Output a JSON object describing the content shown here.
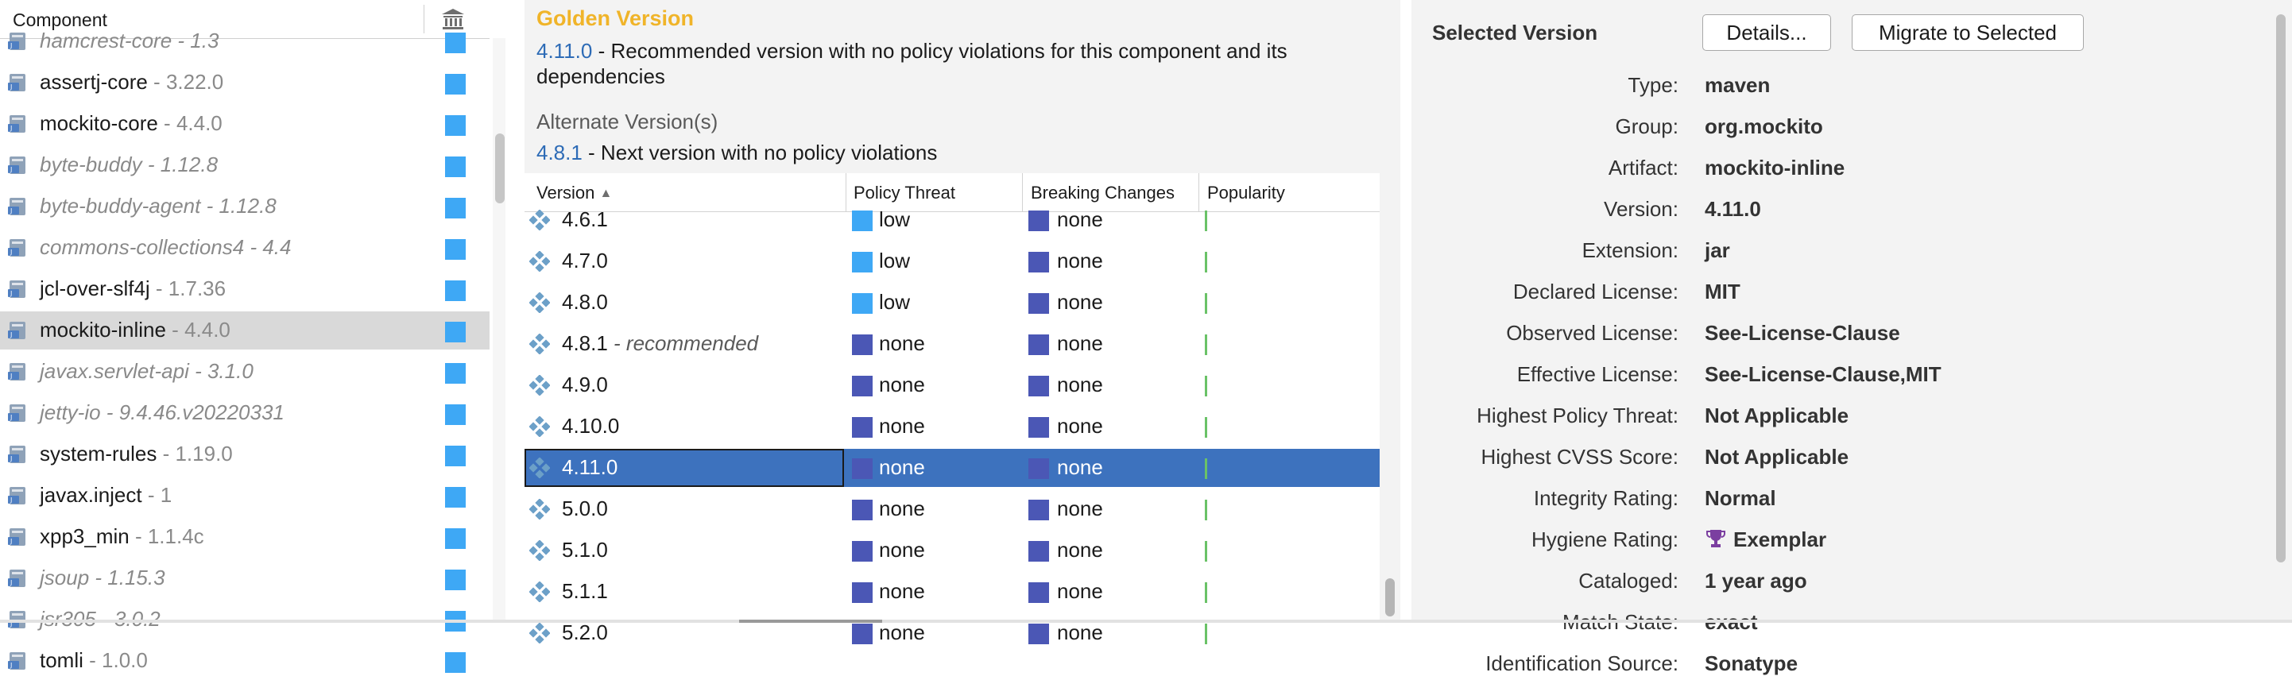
{
  "components_panel": {
    "header_label": "Component",
    "header_icon": "bank-icon",
    "rows": [
      {
        "name": "hamcrest-core",
        "version": "1.3",
        "dimmed": true
      },
      {
        "name": "assertj-core",
        "version": "3.22.0",
        "dimmed": false
      },
      {
        "name": "mockito-core",
        "version": "4.4.0",
        "dimmed": false
      },
      {
        "name": "byte-buddy",
        "version": "1.12.8",
        "dimmed": true
      },
      {
        "name": "byte-buddy-agent",
        "version": "1.12.8",
        "dimmed": true
      },
      {
        "name": "commons-collections4",
        "version": "4.4",
        "dimmed": true
      },
      {
        "name": "jcl-over-slf4j",
        "version": "1.7.36",
        "dimmed": false
      },
      {
        "name": "mockito-inline",
        "version": "4.4.0",
        "dimmed": false,
        "selected": true
      },
      {
        "name": "javax.servlet-api",
        "version": "3.1.0",
        "dimmed": true
      },
      {
        "name": "jetty-io",
        "version": "9.4.46.v20220331",
        "dimmed": true
      },
      {
        "name": "system-rules",
        "version": "1.19.0",
        "dimmed": false
      },
      {
        "name": "javax.inject",
        "version": "1",
        "dimmed": false
      },
      {
        "name": "xpp3_min",
        "version": "1.1.4c",
        "dimmed": false
      },
      {
        "name": "jsoup",
        "version": "1.15.3",
        "dimmed": true
      },
      {
        "name": "jsr305",
        "version": "3.0.2",
        "dimmed": true
      },
      {
        "name": "tomli",
        "version": "1.0.0",
        "dimmed": false
      }
    ],
    "separator": " - "
  },
  "golden": {
    "title": "Golden Version",
    "version": "4.11.0",
    "description": " - Recommended version with no policy violations for this component and its dependencies"
  },
  "alternate": {
    "title": "Alternate Version(s)",
    "version": "4.8.1",
    "description": " - Next version with no policy violations"
  },
  "versions_table": {
    "headers": {
      "version": "Version",
      "policy_threat": "Policy Threat",
      "breaking_changes": "Breaking Changes",
      "popularity": "Popularity"
    },
    "sort_indicator": "▲",
    "rows": [
      {
        "version": "4.6.1",
        "note": "",
        "policy_threat": "low",
        "breaking_changes": "none"
      },
      {
        "version": "4.7.0",
        "note": "",
        "policy_threat": "low",
        "breaking_changes": "none"
      },
      {
        "version": "4.8.0",
        "note": "",
        "policy_threat": "low",
        "breaking_changes": "none"
      },
      {
        "version": "4.8.1",
        "note": " - recommended",
        "policy_threat": "none",
        "breaking_changes": "none"
      },
      {
        "version": "4.9.0",
        "note": "",
        "policy_threat": "none",
        "breaking_changes": "none"
      },
      {
        "version": "4.10.0",
        "note": "",
        "policy_threat": "none",
        "breaking_changes": "none"
      },
      {
        "version": "4.11.0",
        "note": "",
        "policy_threat": "none",
        "breaking_changes": "none",
        "selected": true
      },
      {
        "version": "5.0.0",
        "note": "",
        "policy_threat": "none",
        "breaking_changes": "none"
      },
      {
        "version": "5.1.0",
        "note": "",
        "policy_threat": "none",
        "breaking_changes": "none"
      },
      {
        "version": "5.1.1",
        "note": "",
        "policy_threat": "none",
        "breaking_changes": "none"
      },
      {
        "version": "5.2.0",
        "note": "",
        "policy_threat": "none",
        "breaking_changes": "none"
      }
    ],
    "colors": {
      "low": "#3ea8f5",
      "none": "#4b57b5",
      "popularity": "#6ac267"
    }
  },
  "selected_version": {
    "title": "Selected Version",
    "details_button": "Details...",
    "migrate_button": "Migrate to Selected",
    "properties": [
      {
        "label": "Type:",
        "value": "maven"
      },
      {
        "label": "Group:",
        "value": "org.mockito"
      },
      {
        "label": "Artifact:",
        "value": "mockito-inline"
      },
      {
        "label": "Version:",
        "value": "4.11.0"
      },
      {
        "label": "Extension:",
        "value": "jar"
      },
      {
        "label": "Declared License:",
        "value": "MIT"
      },
      {
        "label": "Observed License:",
        "value": "See-License-Clause"
      },
      {
        "label": "Effective License:",
        "value": "See-License-Clause,MIT"
      },
      {
        "label": "Highest Policy Threat:",
        "value": "Not Applicable"
      },
      {
        "label": "Highest CVSS Score:",
        "value": "Not Applicable"
      },
      {
        "label": "Integrity Rating:",
        "value": "Normal"
      },
      {
        "label": "Hygiene Rating:",
        "value": "Exemplar",
        "icon": "trophy-icon"
      },
      {
        "label": "Cataloged:",
        "value": "1 year ago"
      },
      {
        "label": "Match State:",
        "value": "exact"
      },
      {
        "label": "Identification Source:",
        "value": "Sonatype"
      }
    ]
  }
}
